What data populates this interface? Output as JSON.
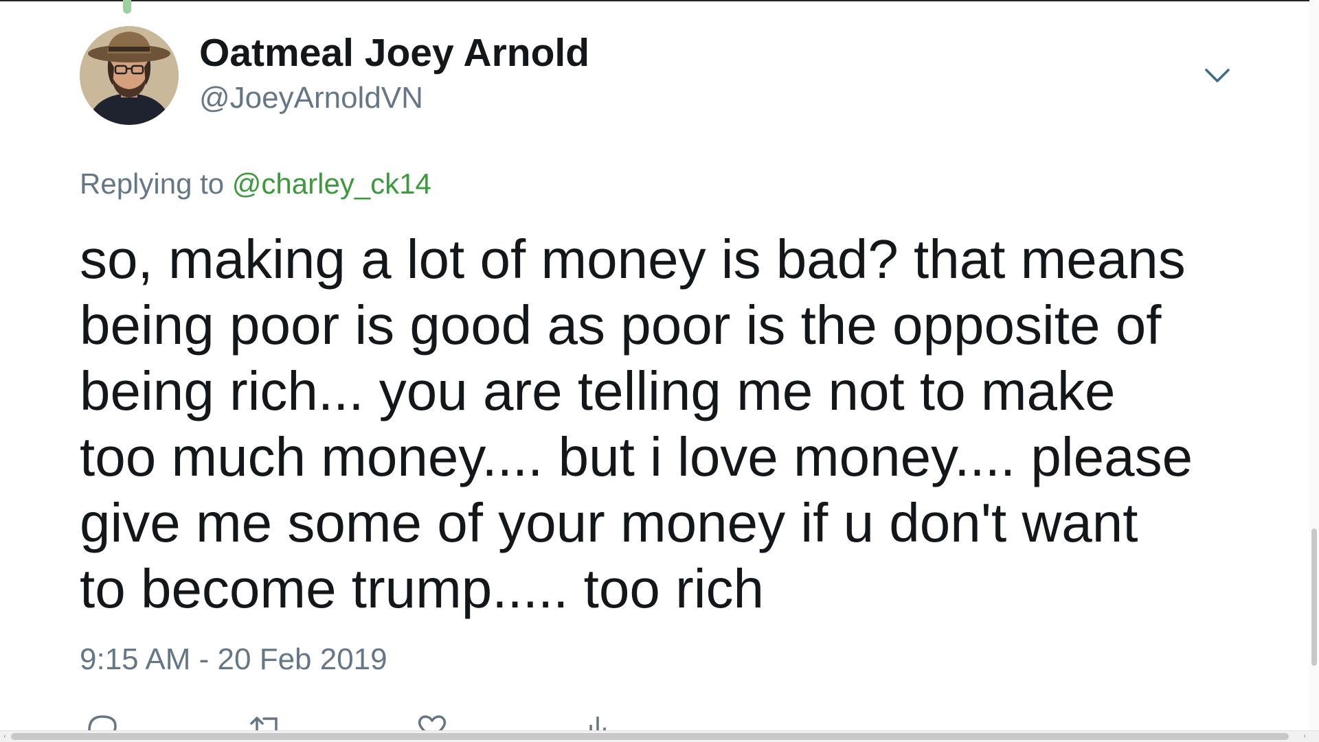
{
  "tweet": {
    "display_name": "Oatmeal Joey Arnold",
    "handle": "@JoeyArnoldVN",
    "replying_prefix": "Replying to ",
    "replying_to": "@charley_ck14",
    "text_lines": [
      "so, making a lot of money is bad? that means",
      "being poor is good as poor is the opposite of",
      "being rich... you are telling me not to make",
      "too much money.... but i love money.... please",
      "give me some of your money if u don't want",
      "to become trump..... too rich"
    ],
    "timestamp": "9:15 AM - 20 Feb 2019"
  },
  "icons": {
    "menu": "chevron-down-icon",
    "reply": "reply-icon",
    "retweet": "retweet-icon",
    "like": "heart-icon",
    "analytics": "analytics-icon"
  },
  "colors": {
    "name": "#14171a",
    "secondary": "#657786",
    "mention": "#3c9a3c",
    "thread_line": "#9ed09e"
  }
}
